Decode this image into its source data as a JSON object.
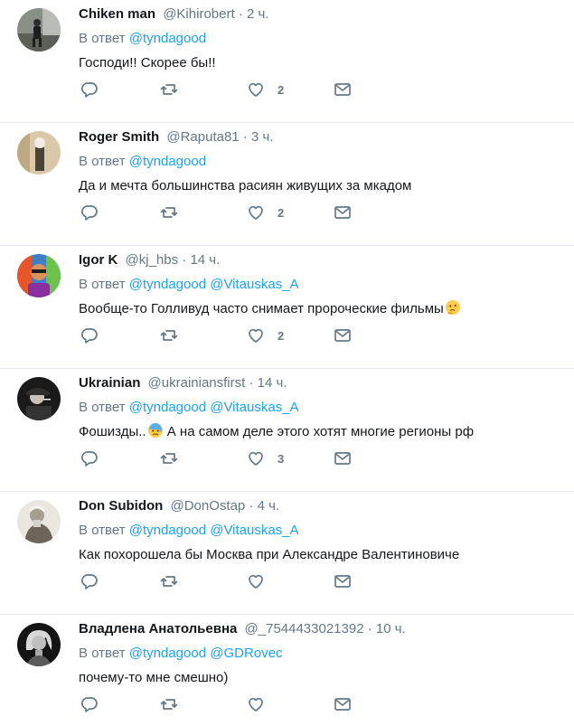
{
  "colors": {
    "link": "#1da1f2",
    "secondary": "#657786",
    "text": "#14171a",
    "divider": "#e6ecf0"
  },
  "reply_prefix": "В ответ",
  "tweets": [
    {
      "name": "Chiken man",
      "handle": "@Kihirobert",
      "dot": "·",
      "time": "2 ч.",
      "mentions": [
        "@tyndagood"
      ],
      "text": "Господи!! Скорее бы!!",
      "emoji": "",
      "likes": "2",
      "avatar_icon": "photo-person-icon"
    },
    {
      "name": "Roger Smith",
      "handle": "@Raputa81",
      "dot": "·",
      "time": "3 ч.",
      "mentions": [
        "@tyndagood"
      ],
      "text": "Да и мечта большинства расиян живущих за мкадом",
      "emoji": "",
      "likes": "2",
      "avatar_icon": "photo-statue-icon"
    },
    {
      "name": "Igor K",
      "handle": "@kj_hbs",
      "dot": "·",
      "time": "14 ч.",
      "mentions": [
        "@tyndagood",
        "@Vitauskas_A"
      ],
      "text": "Вообще-то Голливуд часто снимает пророческие фильмы",
      "emoji": "thinking-face-icon",
      "likes": "2",
      "avatar_icon": "photo-colorful-person-icon"
    },
    {
      "name": "Ukrainian",
      "handle": "@ukrainiansfirst",
      "dot": "·",
      "time": "14 ч.",
      "mentions": [
        "@tyndagood",
        "@Vitauskas_A"
      ],
      "text_before": "Фошизды..",
      "emoji": "anxious-face-icon",
      "text": "А на самом деле этого хотят многие регионы рф",
      "likes": "3",
      "avatar_icon": "photo-man-cap-icon"
    },
    {
      "name": "Don Subidon",
      "handle": "@DonOstap",
      "dot": "·",
      "time": "4 ч.",
      "mentions": [
        "@tyndagood",
        "@Vitauskas_A"
      ],
      "text": "Как похорошела бы Москва при Александре Валентиновиче",
      "emoji": "",
      "likes": "",
      "avatar_icon": "photo-old-man-icon"
    },
    {
      "name": "Владлена Анатольевна",
      "handle": "@_7544433021392",
      "dot": "·",
      "time": "10 ч.",
      "mentions": [
        "@tyndagood",
        "@GDRovec"
      ],
      "text": "почему-то мне смешно)",
      "emoji": "",
      "likes": "",
      "avatar_icon": "photo-woman-bw-icon"
    }
  ]
}
